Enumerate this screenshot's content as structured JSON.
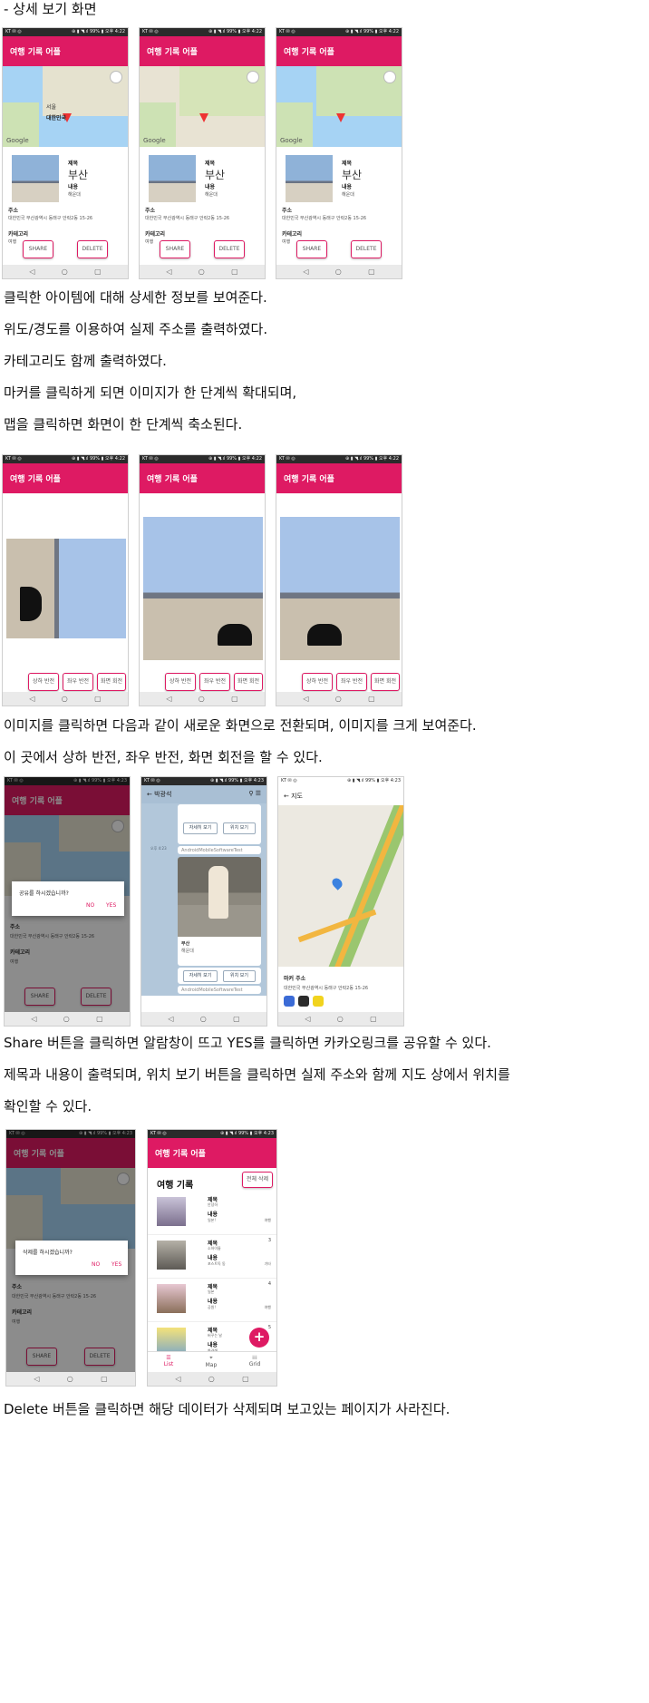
{
  "section_heading": "- 상세 보기 화면",
  "paragraphs": {
    "p1": "클릭한 아이템에 대해 상세한 정보를 보여준다.",
    "p2": "위도/경도를 이용하여 실제 주소를 출력하였다.",
    "p3": "카테고리도 함께 출력하였다.",
    "p4": "마커를 클릭하게 되면 이미지가 한 단계씩 확대되며,",
    "p5": "맵을 클릭하면 화면이 한 단계씩 축소된다.",
    "p6": "이미지를 클릭하면 다음과 같이 새로운 화면으로 전환되며, 이미지를 크게 보여준다.",
    "p7": "이 곳에서 상하 반전, 좌우 반전, 화면 회전을 할 수 있다.",
    "p8": "Share 버튼을 클릭하면 알람창이 뜨고 YES를 클릭하면 카카오링크를 공유할 수 있다.",
    "p9": "제목과 내용이 출력되며, 위치 보기 버튼을 클릭하면 실제 주소와 함께 지도 상에서 위치를",
    "p10": "확인할 수 있다.",
    "p11": "Delete 버튼을 클릭하면 해당 데이터가 삭제되며 보고있는 페이지가 사라진다."
  },
  "status_bar": {
    "left": "KT ✉ ◎",
    "right": "⊕ ▮ ◥.ıl 99% ▮ 오후 4:22",
    "right_late": "⊕ ▮ ◥.ıl 99% ▮ 오후 4:23"
  },
  "app_title": "여행 기록 어플",
  "map": {
    "google": "Google",
    "korea": "대한민국",
    "seoul": "서울"
  },
  "detail": {
    "title_label": "제목",
    "title_value": "부산",
    "content_label": "내용",
    "content_value": "해운대",
    "address_label": "주소",
    "address_value": "대한민국 부산광역시 동래구 안락2동 15-26",
    "category_label": "카테고리",
    "category_value": "여행",
    "share_button": "SHARE",
    "delete_button": "DELETE"
  },
  "nav_icons": {
    "back": "◁",
    "home": "○",
    "recent": "▢"
  },
  "image_view": {
    "flip_vertical": "상하 반전",
    "flip_horizontal": "좌우 반전",
    "rotate": "화면 회전"
  },
  "share_dialog": {
    "message": "공유를 하시겠습니까?",
    "no": "NO",
    "yes": "YES"
  },
  "kakao": {
    "chat_name": "박광석",
    "date": "오후 4:23",
    "detail_button": "자세히 보기",
    "location_button": "위치 보기",
    "app_name": "AndroidMobileSoftwareTest",
    "card_title": "부산",
    "card_desc": "해운대"
  },
  "map_screen": {
    "title": "지도",
    "marker_label": "마커 주소",
    "address": "대한민국 부산광역시 동래구 안락2동 15-26"
  },
  "delete_dialog": {
    "message": "삭제를 하시겠습니까?",
    "no": "NO",
    "yes": "YES"
  },
  "list_screen": {
    "heading": "여행 기록",
    "delete_all": "전체 삭제",
    "items": [
      {
        "title": "제목",
        "title_value": "안녕하",
        "content": "내용",
        "content_value": "일본!",
        "category": "여행",
        "number": ""
      },
      {
        "title": "제목",
        "title_value": "소하이룽",
        "content": "내용",
        "content_value": "포스트독 동",
        "category": "기타",
        "number": "3"
      },
      {
        "title": "제목",
        "title_value": "일본",
        "content": "내용",
        "content_value": "공원!",
        "category": "여행",
        "number": "4"
      },
      {
        "title": "제목",
        "title_value": "버꾸는 날",
        "content": "내용",
        "content_value": "화려해",
        "category": "",
        "number": "5"
      }
    ],
    "tabs": {
      "list": "List",
      "map": "Map",
      "grid": "Grid"
    }
  }
}
